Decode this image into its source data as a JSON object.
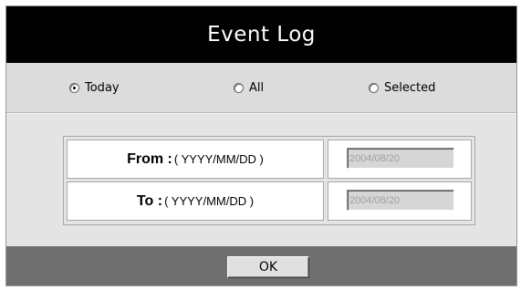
{
  "title": "Event Log",
  "range_options": [
    {
      "label": "Today",
      "checked": true
    },
    {
      "label": "All",
      "checked": false
    },
    {
      "label": "Selected",
      "checked": false
    }
  ],
  "date_range": {
    "from": {
      "label": "From :",
      "hint": "( YYYY/MM/DD )",
      "value": "2004/08/20"
    },
    "to": {
      "label": "To :",
      "hint": "( YYYY/MM/DD )",
      "value": "2004/08/20"
    }
  },
  "ok_label": "OK",
  "colors": {
    "title_bg": "#000000",
    "panel_bg": "#dcdcdc",
    "footer_bg": "#6f6f6f",
    "disabled_input_bg": "#d6d6d6"
  }
}
